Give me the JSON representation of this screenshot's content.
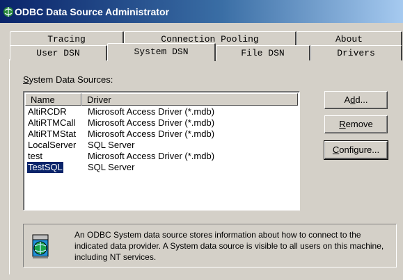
{
  "window": {
    "title": "ODBC Data Source Administrator"
  },
  "tabs": {
    "back_row": [
      {
        "label": "Tracing"
      },
      {
        "label": "Connection Pooling"
      },
      {
        "label": "About"
      }
    ],
    "front_row": [
      {
        "label": "User DSN"
      },
      {
        "label": "System DSN",
        "active": true
      },
      {
        "label": "File DSN"
      },
      {
        "label": "Drivers"
      }
    ]
  },
  "group": {
    "label_prefix": "S",
    "label_rest": "ystem Data Sources:"
  },
  "list": {
    "columns": [
      "Name",
      "Driver"
    ],
    "rows": [
      {
        "name": "AltiRCDR",
        "driver": "Microsoft Access Driver (*.mdb)"
      },
      {
        "name": "AltiRTMCall",
        "driver": "Microsoft Access Driver (*.mdb)"
      },
      {
        "name": "AltiRTMStat",
        "driver": "Microsoft Access Driver (*.mdb)"
      },
      {
        "name": "LocalServer",
        "driver": "SQL Server"
      },
      {
        "name": "test",
        "driver": "Microsoft Access Driver (*.mdb)"
      },
      {
        "name": "TestSQL",
        "driver": "SQL Server",
        "selected": true
      }
    ]
  },
  "buttons": {
    "add": {
      "pre": "A",
      "key": "d",
      "post": "d..."
    },
    "remove": {
      "pre": "",
      "key": "R",
      "post": "emove"
    },
    "configure": {
      "pre": "",
      "key": "C",
      "post": "onfigure..."
    }
  },
  "info": {
    "icon": "database-globe-icon",
    "text": "An ODBC System data source stores information about how to connect to the indicated data provider.  A System data source is visible to all users on this machine, including NT services."
  }
}
